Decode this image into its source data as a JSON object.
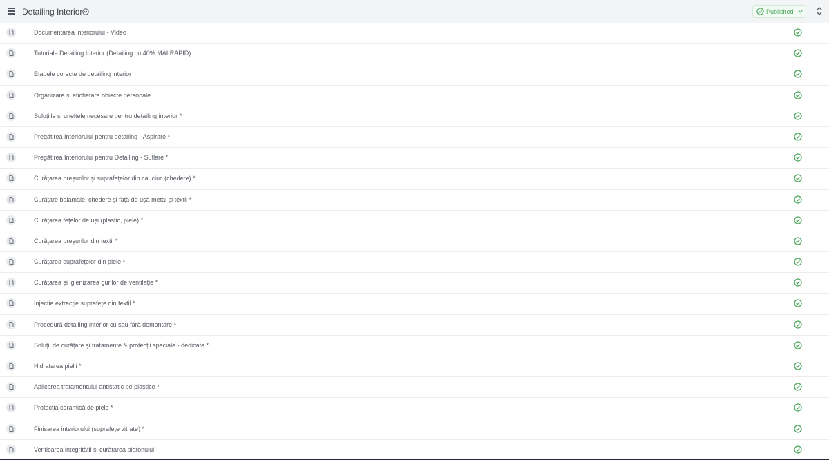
{
  "header": {
    "title": "Detailing Interior",
    "status_label": "Published",
    "menu_icon": "hamburger-menu-icon",
    "collapse_icon": "chevron-up-down-icon"
  },
  "colors": {
    "accent_green": "#4aa55a",
    "header_bg": "#f3f4f6"
  },
  "lessons": [
    {
      "title": "Documentarea interiorului - Video",
      "status": "published"
    },
    {
      "title": "Tutoriale Detailing Interior (Detailing cu 40% MAI RAPID)",
      "status": "published"
    },
    {
      "title": "Etapele corecte de detailing interior",
      "status": "published"
    },
    {
      "title": "Organizare și etichetare obiecte personale",
      "status": "published"
    },
    {
      "title": "Soluțiile și uneltele necesare pentru detailing interior *",
      "status": "published"
    },
    {
      "title": "Pregătirea Interiorului pentru detailing - Aspirare *",
      "status": "published"
    },
    {
      "title": "Pregătirea Interiorului pentru Detailing - Suflare *",
      "status": "published"
    },
    {
      "title": "Curățarea preșurilor și suprafețelor din cauciuc (chedere) *",
      "status": "published"
    },
    {
      "title": "Curățare balamale, chedere și față de ușă metal și textil *",
      "status": "published"
    },
    {
      "title": "Curățarea fețelor de uși (plastic, piele) *",
      "status": "published"
    },
    {
      "title": "Curățarea preșurilor din textil *",
      "status": "published"
    },
    {
      "title": "Curățarea suprafețelor din piele *",
      "status": "published"
    },
    {
      "title": "Curățarea și igienizarea gurilor de ventilație *",
      "status": "published"
    },
    {
      "title": "Injecție extracție suprafețe din textil *",
      "status": "published"
    },
    {
      "title": "Procedură detailing interior cu sau fără demontare *",
      "status": "published"
    },
    {
      "title": "Soluții de curățare și tratamente & protecții speciale - dedicate *",
      "status": "published"
    },
    {
      "title": "Hidratarea pielii *",
      "status": "published"
    },
    {
      "title": "Aplicarea tratamentului antistatic pe plastice *",
      "status": "published"
    },
    {
      "title": "Protecția ceramică de piele *",
      "status": "published"
    },
    {
      "title": "Finisarea interiorului (suprafețe vitrate) *",
      "status": "published"
    },
    {
      "title": "Verificarea integrității și curățarea plafonului",
      "status": "published"
    }
  ]
}
